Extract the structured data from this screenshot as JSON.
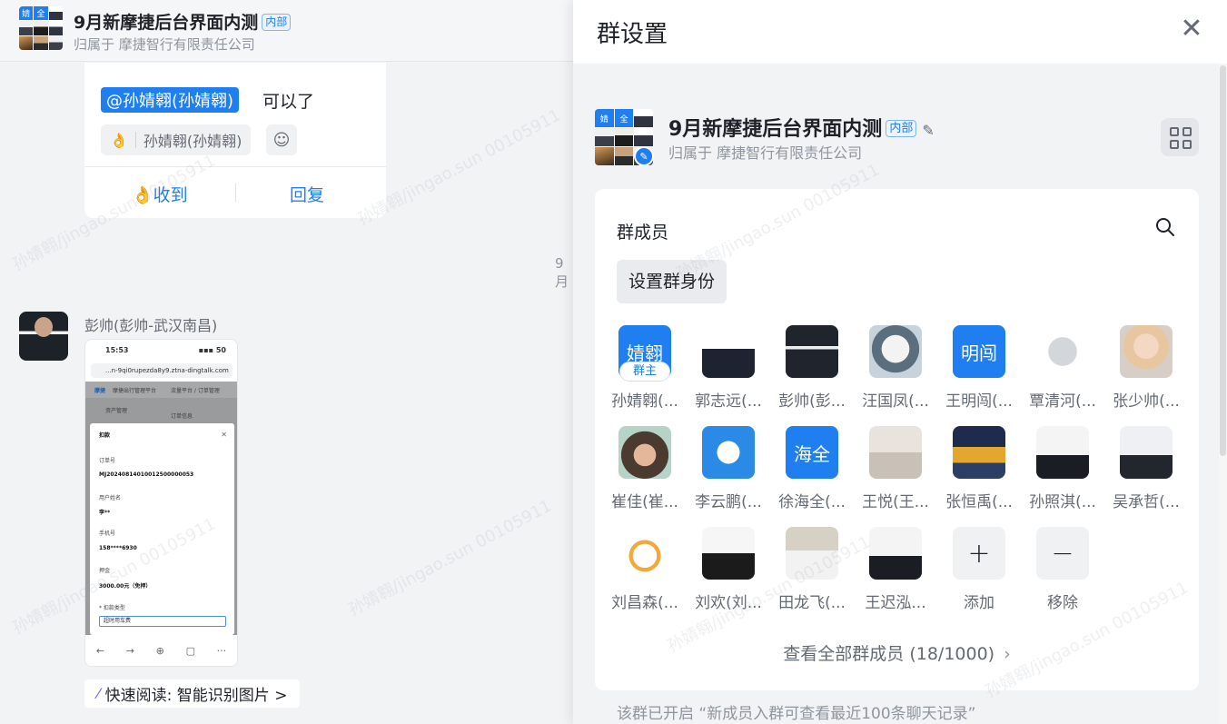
{
  "chat": {
    "group_title": "9月新摩捷后台界面内测",
    "internal_tag": "内部",
    "belongs_to": "归属于 摩捷智行有限责任公司",
    "message": {
      "mention": "@孙婧翱(孙婧翱)",
      "text": "可以了",
      "reaction_emoji": "👌",
      "reaction_user": "孙婧翱(孙婧翱)",
      "btn_received": "收到",
      "btn_reply": "回复"
    },
    "time_partial": "9月",
    "sender_name": "彭帅(彭帅-武汉南昌)",
    "screenshot": {
      "time": "15:53",
      "signal": "50",
      "url": "...n-9qi0rupezda8y9.ztna-dingtalk.com",
      "brand": "摩捷",
      "platform": "摩捷出行管理平台",
      "crumb": "流量平台 / 订单管理",
      "menu": "资产管理",
      "order_info": "订单信息",
      "modal_title": "扣款",
      "order_no_label": "订单号",
      "order_no": "MJ20240814010012500000053",
      "user_name_label": "用户姓名",
      "user_name": "李**",
      "phone_label": "手机号",
      "phone": "158****6930",
      "deposit_label": "押金",
      "deposit": "3000.00元（免押）",
      "deduct_type_label": "* 扣款类型",
      "deduct_type": "超时用车费"
    },
    "quick_read": "快速阅读: 智能识别图片 >"
  },
  "panel": {
    "title": "群设置",
    "group_title": "9月新摩捷后台界面内测",
    "internal_tag": "内部",
    "belongs_to": "归属于 摩捷智行有限责任公司",
    "members_title": "群成员",
    "set_identity": "设置群身份",
    "owner_tag": "群主",
    "members": [
      {
        "name": "孙婧翱(...",
        "avatar_text": "婧翱"
      },
      {
        "name": "郭志远(..."
      },
      {
        "name": "彭帅(彭..."
      },
      {
        "name": "汪国凤(..."
      },
      {
        "name": "王明闯(...",
        "avatar_text": "明闯"
      },
      {
        "name": "覃清河(..."
      },
      {
        "name": "张少帅(..."
      },
      {
        "name": "崔佳(崔..."
      },
      {
        "name": "李云鹏(..."
      },
      {
        "name": "徐海全(...",
        "avatar_text": "海全"
      },
      {
        "name": "王悦(王..."
      },
      {
        "name": "张恒禹(..."
      },
      {
        "name": "孙照淇(..."
      },
      {
        "name": "吴承哲(..."
      },
      {
        "name": "刘昌森(..."
      },
      {
        "name": "刘欢(刘..."
      },
      {
        "name": "田龙飞(..."
      },
      {
        "name": "王迟泓..."
      }
    ],
    "add_label": "添加",
    "remove_label": "移除",
    "view_all": "查看全部群成员 (18/1000)",
    "note": "该群已开启 “新成员入群可查看最近100条聊天记录”"
  },
  "watermark": "孙婧翱/jingao.sun 00105911",
  "colors": {
    "accent": "#1f7ff0",
    "background": "#f2f3f5",
    "text_primary": "#1f2329",
    "text_secondary": "#646a73"
  }
}
